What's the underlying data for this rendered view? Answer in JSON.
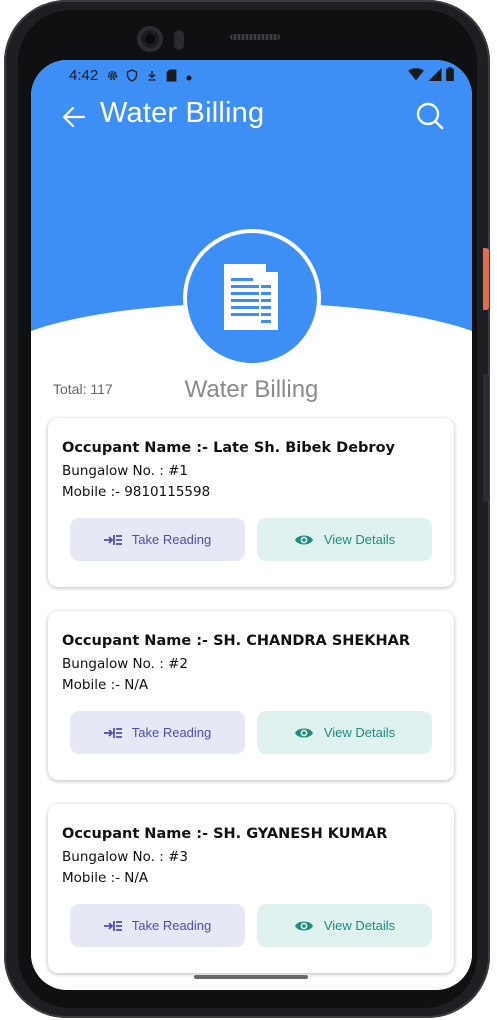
{
  "status_bar": {
    "time": "4:42"
  },
  "app_bar": {
    "title": "Water Billing"
  },
  "summary": {
    "total_text": "Total: 117",
    "section_title": "Water Billing"
  },
  "colors": {
    "primary": "#3d8ff5",
    "take_reading": "#4a4eb0",
    "view_details": "#1e8c7e"
  },
  "occupants": [
    {
      "name": "Occupant Name :- Late Sh. Bibek Debroy",
      "bungalow": "Bungalow No. : #1",
      "mobile": "Mobile :- 9810115598",
      "take_label": "Take Reading",
      "view_label": "View Details"
    },
    {
      "name": "Occupant Name :- SH. CHANDRA SHEKHAR",
      "bungalow": "Bungalow No. : #2",
      "mobile": "Mobile :- N/A",
      "take_label": "Take Reading",
      "view_label": "View Details"
    },
    {
      "name": "Occupant Name :- SH. GYANESH KUMAR",
      "bungalow": "Bungalow No. : #3",
      "mobile": "Mobile :- N/A",
      "take_label": "Take Reading",
      "view_label": "View Details"
    }
  ]
}
